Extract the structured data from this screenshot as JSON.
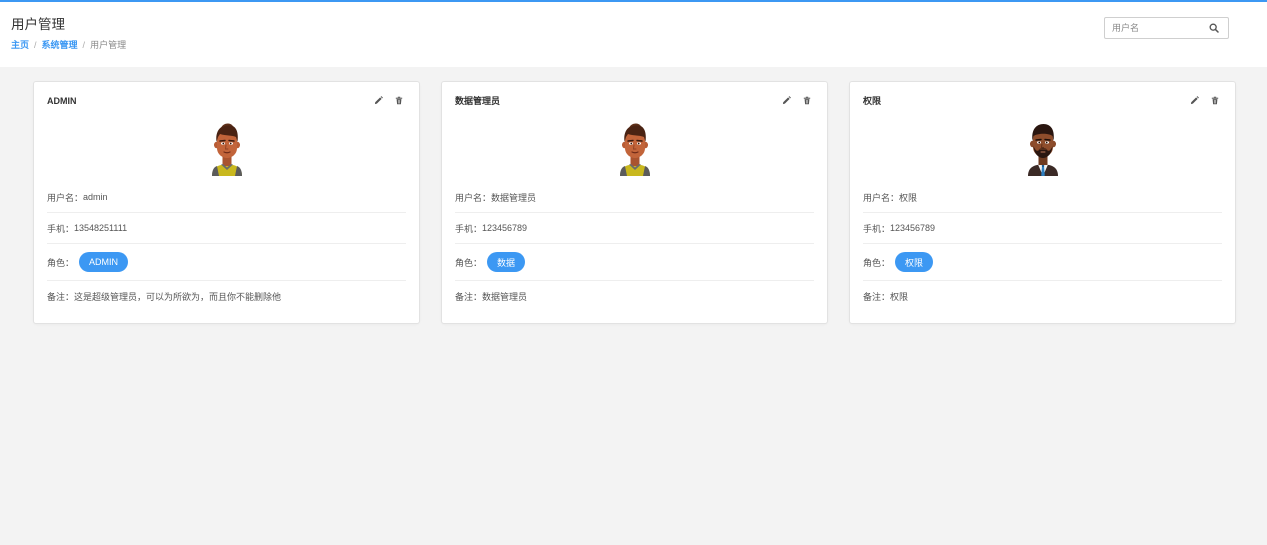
{
  "colors": {
    "accent": "#3c98f3",
    "page_background": "#f3f3f3",
    "card_background": "#ffffff",
    "text": "#555555"
  },
  "header": {
    "title": "用户管理",
    "breadcrumb": [
      {
        "label": "主页",
        "link": true
      },
      {
        "label": "系统管理",
        "link": true
      },
      {
        "label": "用户管理",
        "link": false
      }
    ],
    "separator": "/",
    "search": {
      "placeholder": "用户名",
      "icon": "search-icon"
    }
  },
  "labels": {
    "username": "用户名：",
    "phone": "手机：",
    "role": "角色：",
    "note": "备注："
  },
  "icons": {
    "edit": "pencil-icon",
    "delete": "trash-icon"
  },
  "cards": [
    {
      "title": "ADMIN",
      "avatar": "avatar-yellow-shirt-icon",
      "username": "admin",
      "phone": "13548251111",
      "role": "ADMIN",
      "note": "这是超级管理员，可以为所欲为，而且你不能删除他"
    },
    {
      "title": "数据管理员",
      "avatar": "avatar-yellow-shirt-icon",
      "username": "数据管理员",
      "phone": "123456789",
      "role": "数据",
      "note": "数据管理员"
    },
    {
      "title": "权限",
      "avatar": "avatar-suit-tie-icon",
      "username": "权限",
      "phone": "123456789",
      "role": "权限",
      "note": "权限"
    }
  ]
}
